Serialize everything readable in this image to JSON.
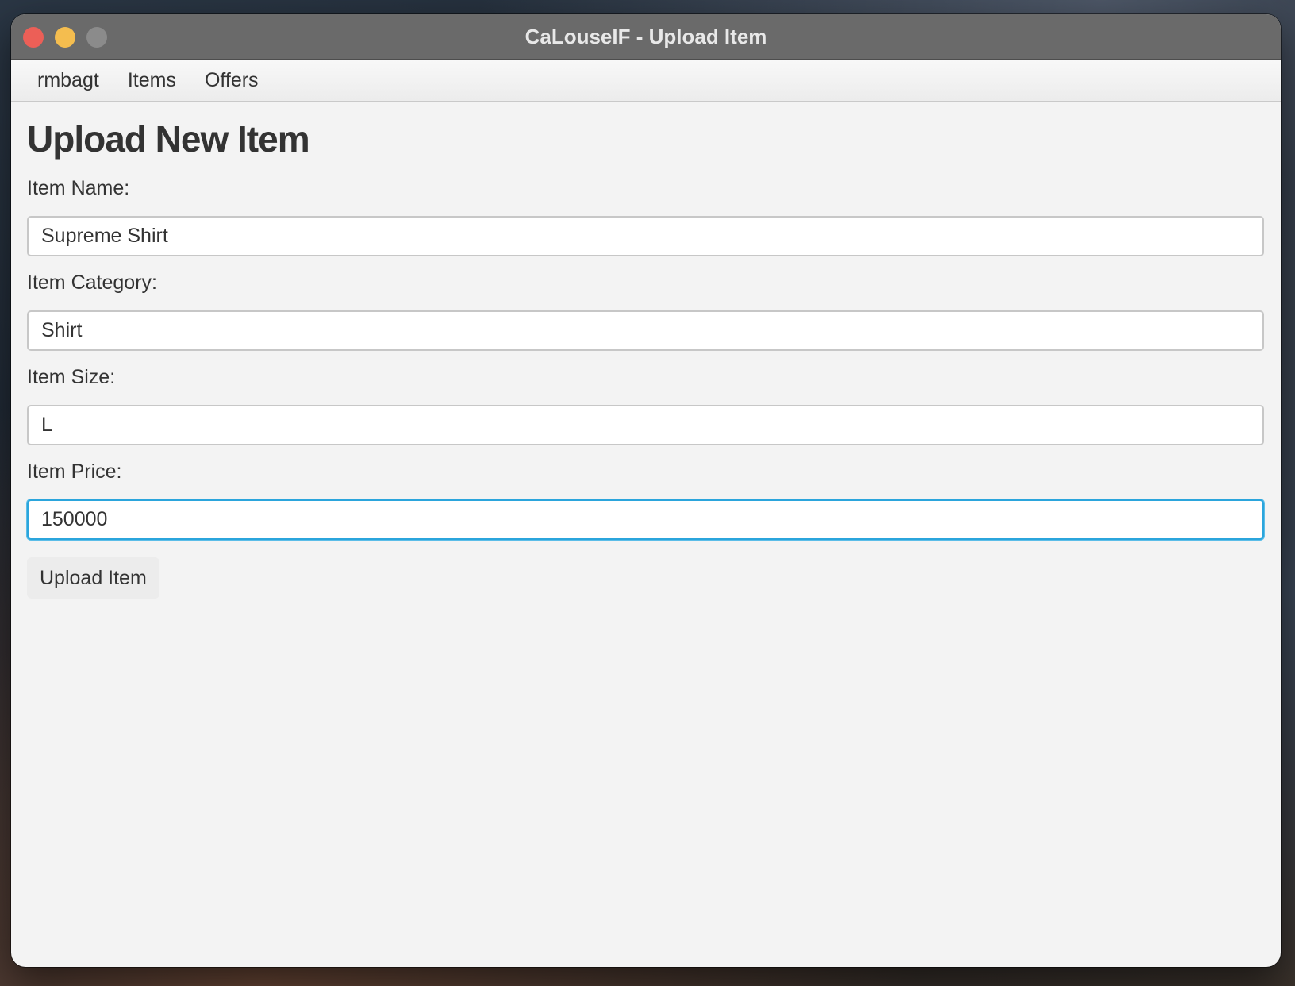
{
  "window": {
    "title": "CaLouselF - Upload Item"
  },
  "menu": {
    "items": [
      {
        "label": "rmbagt"
      },
      {
        "label": "Items"
      },
      {
        "label": "Offers"
      }
    ]
  },
  "form": {
    "heading": "Upload New Item",
    "name_label": "Item Name:",
    "name_value": "Supreme Shirt",
    "category_label": "Item Category:",
    "category_value": "Shirt",
    "size_label": "Item Size:",
    "size_value": "L",
    "price_label": "Item Price:",
    "price_value": "150000",
    "submit_label": "Upload Item"
  },
  "colors": {
    "focus_ring": "#2ba5dc",
    "close_button": "#ec5f57",
    "minimize_button": "#f4bd4f",
    "maximize_button": "#8b8b8b"
  }
}
